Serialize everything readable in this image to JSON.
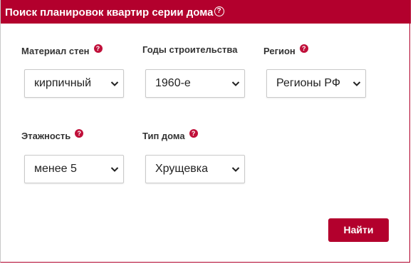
{
  "header": {
    "title": "Поиск планировок квартир серии дома",
    "help_glyph": "?"
  },
  "help_glyph": "?",
  "fields": {
    "wall_material": {
      "label": "Материал стен",
      "value": "кирпичный"
    },
    "build_years": {
      "label": "Годы строительства",
      "value": "1960-е"
    },
    "region": {
      "label": "Регион",
      "value": "Регионы РФ"
    },
    "floors": {
      "label": "Этажность",
      "value": "менее 5"
    },
    "house_type": {
      "label": "Тип дома",
      "value": "Хрущевка"
    }
  },
  "search_button": {
    "label": "Найти"
  },
  "colors": {
    "accent": "#b3002d",
    "help_dot": "#c0103a",
    "label_text": "#333333"
  },
  "icons": {
    "help": "help-circle-icon",
    "dropdown": "chevron-down-icon"
  }
}
